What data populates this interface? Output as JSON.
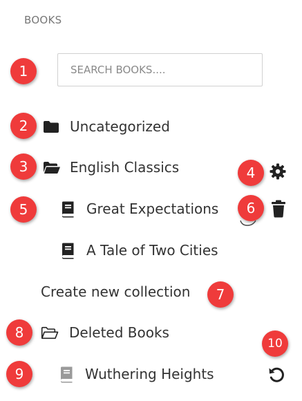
{
  "header": {
    "title": "BOOKS"
  },
  "search": {
    "placeholder": "SEARCH BOOKS...."
  },
  "markers": [
    "1",
    "2",
    "3",
    "4",
    "5",
    "6",
    "7",
    "8",
    "9",
    "10"
  ],
  "tree": {
    "uncategorized_label": "Uncategorized",
    "english_classics_label": "English Classics",
    "book_great_expectations": "Great Expectations",
    "book_tale_two_cities": "A Tale of Two Cities",
    "create_collection_label": "Create new collection",
    "deleted_books_label": "Deleted Books",
    "book_wuthering_heights": "Wuthering Heights"
  },
  "icons": {
    "collapsed_folder": "folder-closed-icon",
    "open_folder": "folder-open-icon",
    "book": "book-icon",
    "settings": "gear-icon",
    "delete": "trash-icon",
    "restore": "undo-icon"
  },
  "colors": {
    "marker_red": "#ef3b3b",
    "icon_dark": "#222222",
    "deleted_book_icon": "#9a9a9a"
  }
}
